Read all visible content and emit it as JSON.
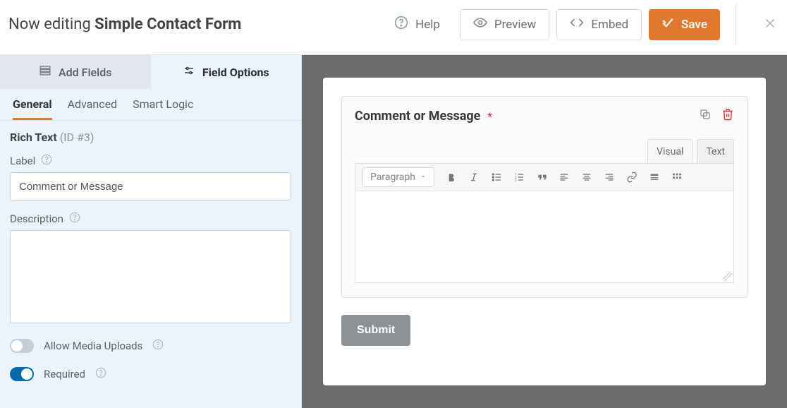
{
  "header": {
    "editing_prefix": "Now editing ",
    "form_name": "Simple Contact Form",
    "help_label": "Help",
    "preview_label": "Preview",
    "embed_label": "Embed",
    "save_label": "Save"
  },
  "sidebar": {
    "tabs": {
      "add_fields": "Add Fields",
      "field_options": "Field Options"
    },
    "subtabs": {
      "general": "General",
      "advanced": "Advanced",
      "smart_logic": "Smart Logic"
    },
    "field": {
      "type": "Rich Text",
      "id_text": "(ID #3)"
    },
    "label_label": "Label",
    "label_value": "Comment or Message",
    "description_label": "Description",
    "description_value": "",
    "toggles": {
      "media_uploads": {
        "label": "Allow Media Uploads",
        "on": false
      },
      "required": {
        "label": "Required",
        "on": true
      }
    }
  },
  "preview": {
    "field_label": "Comment or Message",
    "required": true,
    "editor": {
      "visual_tab": "Visual",
      "text_tab": "Text",
      "format_select": "Paragraph"
    },
    "submit_label": "Submit"
  }
}
